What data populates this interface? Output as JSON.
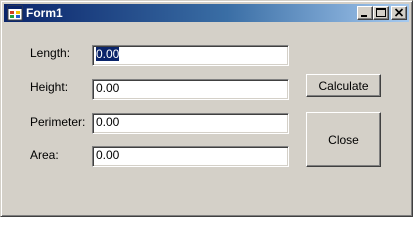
{
  "window": {
    "title": "Form1",
    "icon": "form-app-icon",
    "controls": [
      "minimize-icon",
      "maximize-icon",
      "close-icon"
    ]
  },
  "form": {
    "length_label": "Length:",
    "length_value": "0.00",
    "height_label": "Height:",
    "height_value": "0.00",
    "perimeter_label": "Perimeter:",
    "perimeter_value": "0.00",
    "area_label": "Area:",
    "area_value": "0.00"
  },
  "buttons": {
    "calculate": "Calculate",
    "close": "Close"
  },
  "colors": {
    "face": "#d4d0c8",
    "title_start": "#0a246a",
    "title_end": "#a6caf0",
    "selection": "#0a246a"
  }
}
